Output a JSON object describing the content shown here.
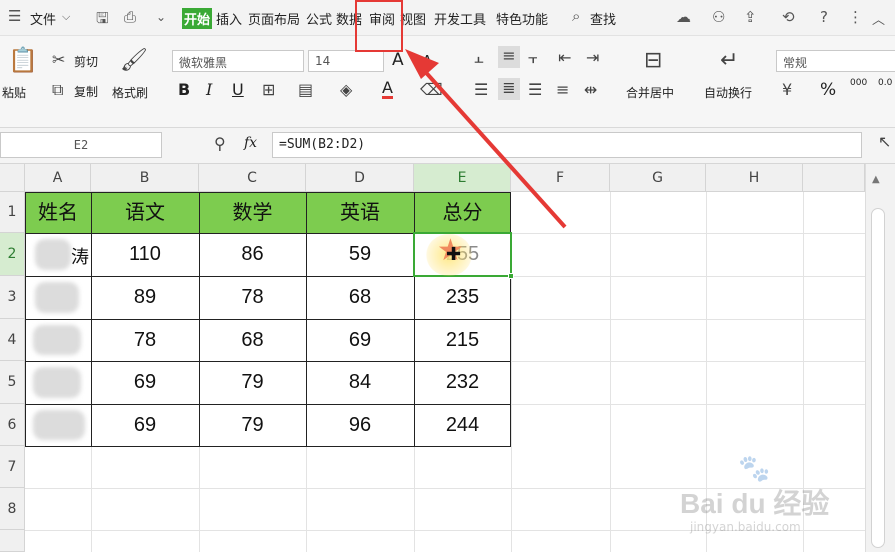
{
  "menubar": {
    "file": "文件",
    "tabs": [
      "开始",
      "插入",
      "页面布局",
      "公式",
      "数据",
      "审阅",
      "视图",
      "开发工具",
      "特色功能"
    ],
    "search": "查找"
  },
  "ribbon": {
    "paste": "粘贴",
    "cut": "剪切",
    "copy": "复制",
    "format_painter": "格式刷",
    "font_name": "微软雅黑",
    "font_size": "14",
    "bold": "B",
    "italic": "I",
    "underline": "U",
    "font_color": "A",
    "grow_font": "A",
    "shrink_font": "A",
    "merge_center": "合并居中",
    "wrap_text": "自动换行",
    "number_format": "常规",
    "percent": "%",
    "decimal_inc": "000",
    "decimal_dec": "0.0"
  },
  "formula_bar": {
    "name_box": "E2",
    "fx": "fx",
    "formula": "=SUM(B2:D2)"
  },
  "sheet": {
    "columns": [
      "A",
      "B",
      "C",
      "D",
      "E",
      "F",
      "G",
      "H"
    ],
    "rows": [
      "1",
      "2",
      "3",
      "4",
      "5",
      "6",
      "7",
      "8"
    ],
    "header": [
      "姓名",
      "语文",
      "数学",
      "英语",
      "总分"
    ],
    "data": [
      {
        "name": "",
        "c1": "110",
        "c2": "86",
        "c3": "59",
        "total": "255"
      },
      {
        "name": "",
        "c1": "89",
        "c2": "78",
        "c3": "68",
        "total": "235"
      },
      {
        "name": "",
        "c1": "78",
        "c2": "68",
        "c3": "69",
        "total": "215"
      },
      {
        "name": "",
        "c1": "69",
        "c2": "79",
        "c3": "84",
        "total": "232"
      },
      {
        "name": "",
        "c1": "69",
        "c2": "79",
        "c3": "96",
        "total": "244"
      }
    ],
    "row2_name_tail": "涛"
  },
  "colors": {
    "header_fill": "#7dcc4f",
    "selection": "#3aa935",
    "annotation": "#e53935",
    "active_tab": "#3aa935"
  },
  "watermark": {
    "brand": "Bai du 经验",
    "url": "jingyan.baidu.com"
  }
}
